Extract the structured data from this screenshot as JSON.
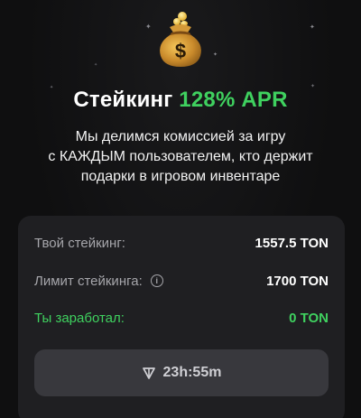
{
  "header": {
    "title_main": "Стейкинг",
    "title_accent": "128% APR",
    "subtitle_line1": "Мы делимся комиссией за игру",
    "subtitle_line2": "с КАЖДЫМ пользователем, кто держит",
    "subtitle_line3": "подарки в игровом инвентаре",
    "bag_icon": "money-bag-icon"
  },
  "stats": {
    "stake_label": "Твой стейкинг:",
    "stake_value": "1557.5 TON",
    "limit_label": "Лимит стейкинга:",
    "limit_value": "1700 TON",
    "earned_label": "Ты заработал:",
    "earned_value": "0 TON"
  },
  "timer": {
    "value": "23h:55m",
    "icon": "ton-icon"
  },
  "colors": {
    "accent_green": "#3fd15f",
    "background": "#0f0f10",
    "card": "#1f1f22",
    "button": "#38383d"
  }
}
